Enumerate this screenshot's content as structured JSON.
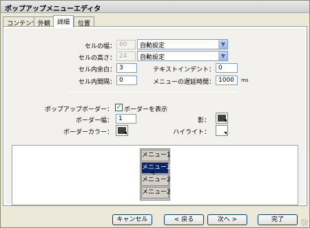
{
  "window": {
    "title": "ポップアップメニューエディタ"
  },
  "tabs": [
    {
      "label": "コンテンツ"
    },
    {
      "label": "外観"
    },
    {
      "label": "詳細"
    },
    {
      "label": "位置"
    }
  ],
  "cell": {
    "width_label": "セルの幅：",
    "width_value": "60",
    "width_mode": "自動設定",
    "height_label": "セルの高さ：",
    "height_value": "24",
    "height_mode": "自動設定",
    "padding_label": "セル内余白：",
    "padding_value": "3",
    "spacing_label": "セル内間隔：",
    "spacing_value": "0",
    "indent_label": "テキストインデント：",
    "indent_value": "0",
    "delay_label": "メニューの遅延時間：",
    "delay_value": "1000",
    "delay_unit": "ms"
  },
  "border": {
    "popup_label": "ポップアップボーダー：",
    "show_label": "ボーダーを表示",
    "show_checked": true,
    "width_label": "ボーダー幅：",
    "width_value": "1",
    "color_label": "ボーダーカラー：",
    "shadow_label": "影：",
    "highlight_label": "ハイライト："
  },
  "colors": {
    "border_color": "#404040",
    "shadow_color": "#404040",
    "highlight_color": "#ffffff",
    "menu_highlight": "#0a246a"
  },
  "preview": {
    "items": [
      "メニュー1",
      "メニュー2",
      "メニュー2",
      "メニュー2"
    ]
  },
  "buttons": {
    "cancel": "キャンセル",
    "back": "< 戻る",
    "next": "次へ >",
    "finish": "完了"
  },
  "icons": {
    "dropdown": "chevron-down-icon",
    "cursor": "mouse-pointer-icon",
    "check": "checkmark-icon"
  }
}
